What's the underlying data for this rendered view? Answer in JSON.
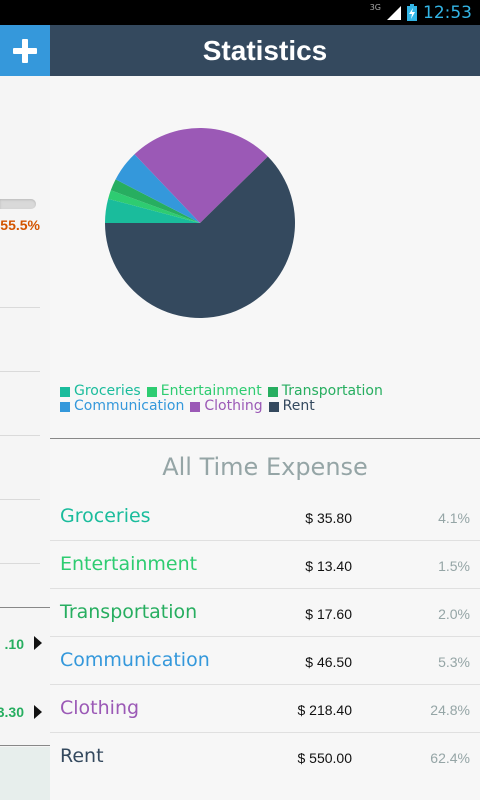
{
  "status_bar": {
    "network": "3G",
    "time": "12:53"
  },
  "left_panel": {
    "percent_text": "55.5%",
    "amounts": [
      ".10",
      "3.30"
    ]
  },
  "header": {
    "title": "Statistics",
    "add_icon": "plus-icon"
  },
  "chart_data": {
    "type": "pie",
    "title": "",
    "slices": [
      {
        "label": "Groceries",
        "value": 4.1,
        "color": "#1abc9c"
      },
      {
        "label": "Entertainment",
        "value": 1.5,
        "color": "#2ecc71"
      },
      {
        "label": "Transportation",
        "value": 2.0,
        "color": "#27ae60"
      },
      {
        "label": "Communication",
        "value": 5.3,
        "color": "#3498db"
      },
      {
        "label": "Clothing",
        "value": 24.8,
        "color": "#9b59b6"
      },
      {
        "label": "Rent",
        "value": 62.4,
        "color": "#34495e"
      }
    ],
    "legend_position": "bottom"
  },
  "legend": [
    {
      "label": "Groceries",
      "color": "#1abc9c"
    },
    {
      "label": "Entertainment",
      "color": "#2ecc71"
    },
    {
      "label": "Transportation",
      "color": "#27ae60"
    },
    {
      "label": "Communication",
      "color": "#3498db"
    },
    {
      "label": "Clothing",
      "color": "#9b59b6"
    },
    {
      "label": "Rent",
      "color": "#34495e"
    }
  ],
  "section_title": "All Time Expense",
  "expenses": [
    {
      "name": "Groceries",
      "amount": "$ 35.80",
      "percent": "4.1%",
      "color": "#1abc9c"
    },
    {
      "name": "Entertainment",
      "amount": "$ 13.40",
      "percent": "1.5%",
      "color": "#2ecc71"
    },
    {
      "name": "Transportation",
      "amount": "$ 17.60",
      "percent": "2.0%",
      "color": "#27ae60"
    },
    {
      "name": "Communication",
      "amount": "$ 46.50",
      "percent": "5.3%",
      "color": "#3498db"
    },
    {
      "name": "Clothing",
      "amount": "$ 218.40",
      "percent": "24.8%",
      "color": "#9b59b6"
    },
    {
      "name": "Rent",
      "amount": "$ 550.00",
      "percent": "62.4%",
      "color": "#34495e"
    }
  ]
}
